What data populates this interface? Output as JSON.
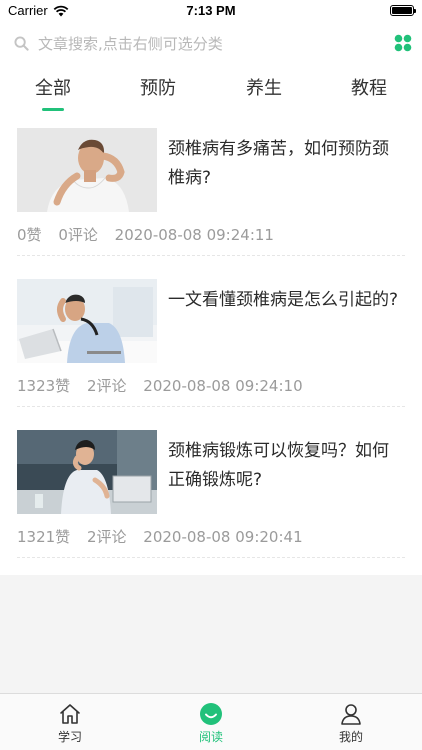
{
  "status_bar": {
    "carrier": "Carrier",
    "time": "7:13 PM"
  },
  "search": {
    "placeholder": "文章搜索,点击右侧可选分类"
  },
  "colors": {
    "accent": "#21c17a"
  },
  "tabs": [
    {
      "label": "全部",
      "active": true
    },
    {
      "label": "预防",
      "active": false
    },
    {
      "label": "养生",
      "active": false
    },
    {
      "label": "教程",
      "active": false
    }
  ],
  "articles": [
    {
      "title": "颈椎病有多痛苦，如何预防颈椎病?",
      "likes": "0赞",
      "comments": "0评论",
      "time": "2020-08-08 09:24:11"
    },
    {
      "title": "一文看懂颈椎病是怎么引起的?",
      "likes": "1323赞",
      "comments": "2评论",
      "time": "2020-08-08 09:24:10"
    },
    {
      "title": "颈椎病锻炼可以恢复吗？如何正确锻炼呢?",
      "likes": "1321赞",
      "comments": "2评论",
      "time": "2020-08-08 09:20:41"
    }
  ],
  "tabbar": [
    {
      "label": "学习",
      "icon": "home-icon",
      "active": false
    },
    {
      "label": "阅读",
      "icon": "smile-icon",
      "active": true
    },
    {
      "label": "我的",
      "icon": "user-icon",
      "active": false
    }
  ]
}
